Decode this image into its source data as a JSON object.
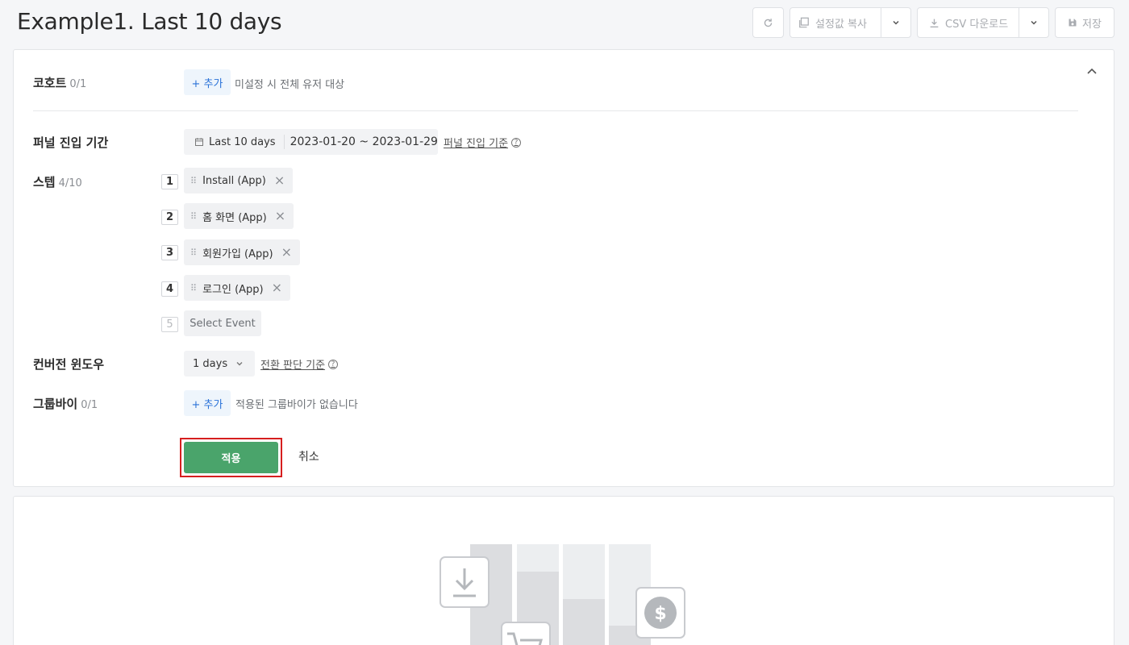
{
  "header": {
    "title": "Example1. Last 10 days",
    "copy_settings_label": "설정값 복사",
    "csv_download_label": "CSV 다운로드",
    "save_label": "저장"
  },
  "cohort": {
    "label": "코호트",
    "count": "0/1",
    "add_label": "+ 추가",
    "hint": "미설정 시 전체 유저 대상"
  },
  "funnel_period": {
    "label": "퍼널 진입 기간",
    "preset": "Last 10 days",
    "range": "2023-01-20 ~ 2023-01-29",
    "criteria_link": "퍼널 진입 기준"
  },
  "steps": {
    "label": "스텝",
    "count": "4/10",
    "items": [
      {
        "num": "1",
        "name": "Install (App)"
      },
      {
        "num": "2",
        "name": "홈 화면 (App)"
      },
      {
        "num": "3",
        "name": "회원가입 (App)"
      },
      {
        "num": "4",
        "name": "로그인 (App)"
      }
    ],
    "next_num": "5",
    "select_placeholder": "Select Event"
  },
  "conversion_window": {
    "label": "컨버전 윈도우",
    "value": "1 days",
    "criteria_link": "전환 판단 기준"
  },
  "group_by": {
    "label": "그룹바이",
    "count": "0/1",
    "add_label": "+ 추가",
    "hint": "적용된 그룹바이가 없습니다"
  },
  "actions": {
    "apply_label": "적용",
    "cancel_label": "취소"
  },
  "colors": {
    "accent_green": "#4aa46b",
    "link_blue": "#2a72d8",
    "highlight_red": "#d61f1f"
  }
}
